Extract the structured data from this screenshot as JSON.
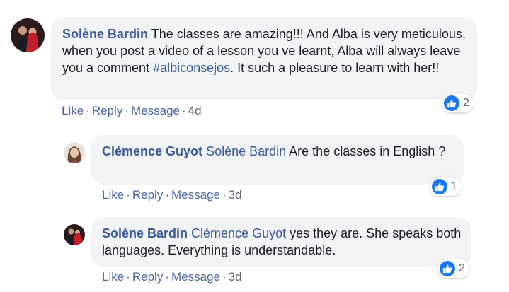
{
  "comments": [
    {
      "author": "Solène Bardin",
      "segments": [
        {
          "type": "text",
          "value": " The classes are amazing!!! And Alba is very meticulous, when you post a video of a lesson you ve learnt, Alba will always leave you a comment "
        },
        {
          "type": "hashtag",
          "value": "#albiconsejos"
        },
        {
          "type": "text",
          "value": ". It such a pleasure to learn with her!!"
        }
      ],
      "actions": {
        "like": "Like",
        "reply": "Reply",
        "message": "Message",
        "time": "4d"
      },
      "reaction": {
        "icon": "thumbs-up-icon",
        "count": "2"
      }
    },
    {
      "author": "Clémence Guyot",
      "mention": "Solène Bardin",
      "text": " Are the classes in English ?",
      "actions": {
        "like": "Like",
        "reply": "Reply",
        "message": "Message",
        "time": "3d"
      },
      "reaction": {
        "icon": "thumbs-up-icon",
        "count": "1"
      }
    },
    {
      "author": "Solène Bardin",
      "mention": "Clémence Guyot",
      "text": " yes they are. She speaks both languages. Everything is understandable.",
      "actions": {
        "like": "Like",
        "reply": "Reply",
        "message": "Message",
        "time": "3d"
      },
      "reaction": {
        "icon": "thumbs-up-icon",
        "count": "2"
      }
    }
  ],
  "separator": "·",
  "colors": {
    "link": "#385898",
    "bubble": "#f2f3f5",
    "like_blue": "#1877f2",
    "meta": "#606770"
  }
}
